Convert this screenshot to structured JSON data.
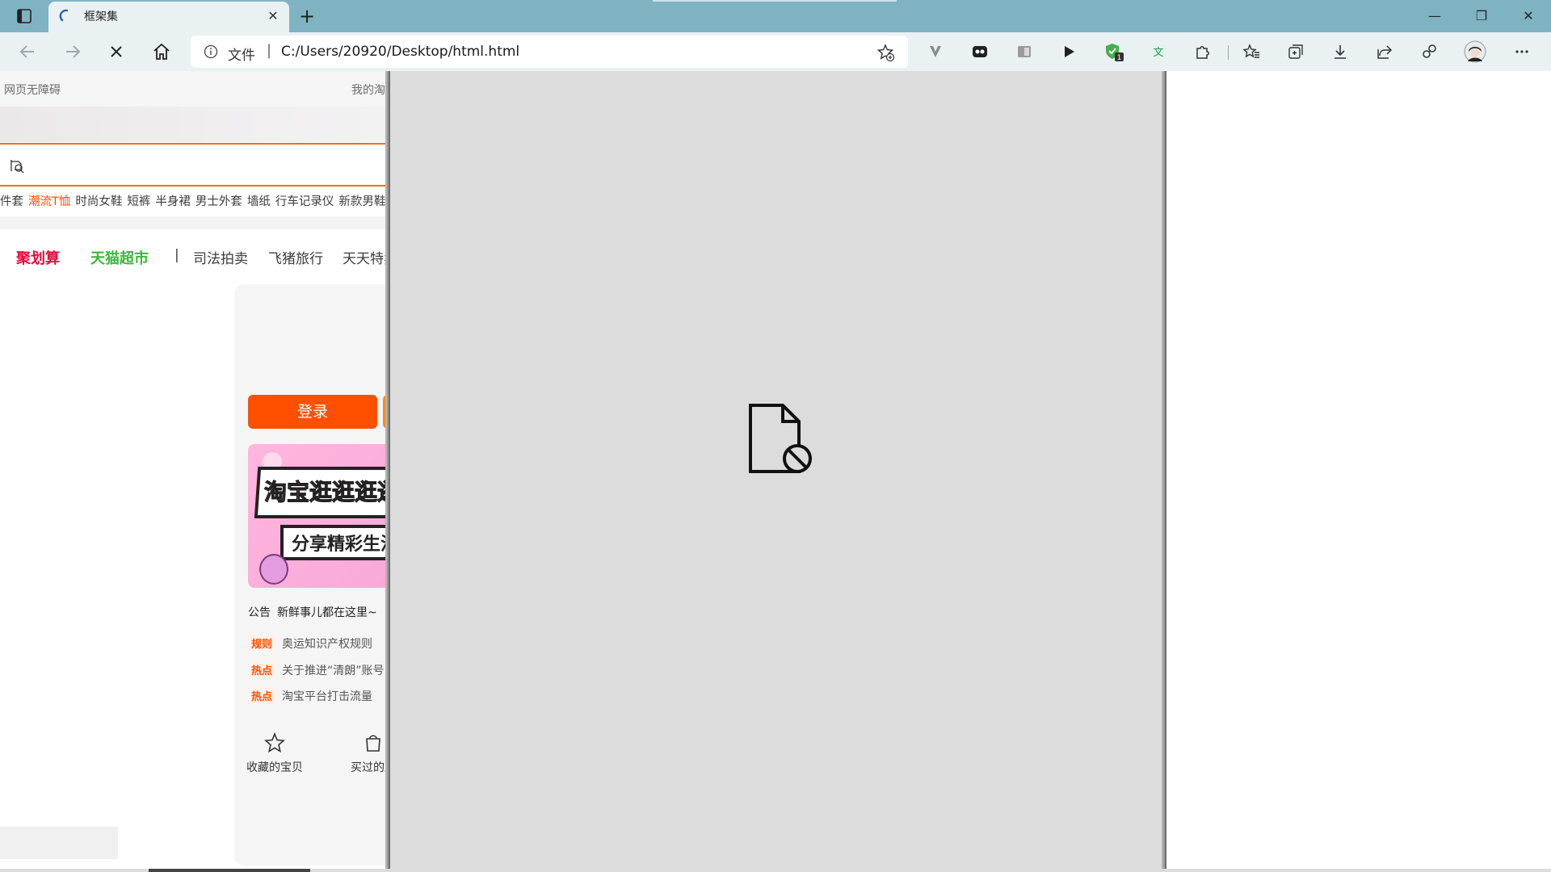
{
  "browser": {
    "tab_title": "框架集",
    "tab_close": "✕",
    "new_tab": "+",
    "scheme_label": "文件",
    "url": "C:/Users/20920/Desktop/html.html",
    "window": {
      "minimize": "—",
      "restore": "❐",
      "close": "✕"
    },
    "extension_badge": "1"
  },
  "left_frame": {
    "topnav": {
      "accessibility": "网页无障碍",
      "mine": "我的淘宝"
    },
    "hotwords": [
      {
        "text": "件套",
        "hot": false
      },
      {
        "text": "潮流T恤",
        "hot": true
      },
      {
        "text": "时尚女鞋",
        "hot": false
      },
      {
        "text": "短裤",
        "hot": false
      },
      {
        "text": "半身裙",
        "hot": false
      },
      {
        "text": "男士外套",
        "hot": false
      },
      {
        "text": "墙纸",
        "hot": false
      },
      {
        "text": "行车记录仪",
        "hot": false
      },
      {
        "text": "新款男鞋",
        "hot": false
      }
    ],
    "channels": {
      "juhuasuan": "聚划算",
      "tmall_market": "天猫超市",
      "separator": "|",
      "auction": "司法拍卖",
      "fliggy": "飞猪旅行",
      "tiantian": "天天特卖"
    },
    "login_label": "登录",
    "promo": {
      "line1": "淘宝逛逛逛逛",
      "line2": "分享精彩生活"
    },
    "notice": {
      "tag": "公告",
      "text": "新鲜事儿都在这里~"
    },
    "news": [
      {
        "badge": "规则",
        "text": "奥运知识产权规则"
      },
      {
        "badge": "热点",
        "text": "关于推进“清朗”账号"
      },
      {
        "badge": "热点",
        "text": "淘宝平台打击流量"
      }
    ],
    "quick": [
      {
        "label": "收藏的宝贝",
        "icon": "star-icon"
      },
      {
        "label": "买过的店",
        "icon": "bag-icon"
      }
    ]
  },
  "middle_frame": {
    "state_icon": "blocked-file-icon"
  },
  "colors": {
    "titlebar": "#7fb3c2",
    "taobao_orange": "#ff5000",
    "juhuasuan_red": "#e60a3c",
    "tmall_green": "#3bb83b",
    "blocked_frame_bg": "#dcdcdc"
  }
}
